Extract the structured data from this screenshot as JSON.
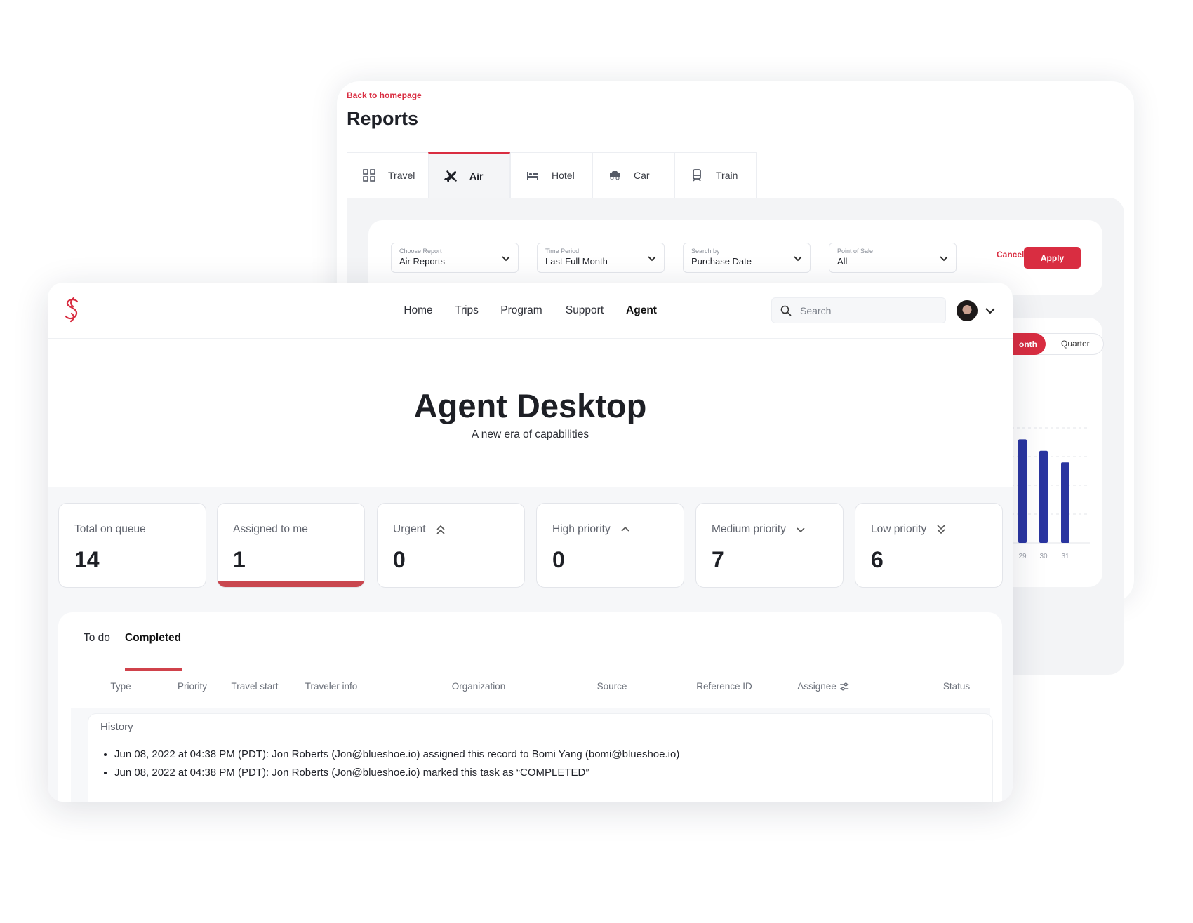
{
  "reports": {
    "back_link": "Back to homepage",
    "title": "Reports",
    "tabs": [
      {
        "label": "Travel",
        "icon": "grid-icon"
      },
      {
        "label": "Air",
        "icon": "plane-icon",
        "active": true
      },
      {
        "label": "Hotel",
        "icon": "bed-icon"
      },
      {
        "label": "Car",
        "icon": "car-icon"
      },
      {
        "label": "Train",
        "icon": "train-icon"
      }
    ],
    "filters": [
      {
        "label": "Choose Report",
        "value": "Air Reports"
      },
      {
        "label": "Time Period",
        "value": "Last Full Month"
      },
      {
        "label": "Search by",
        "value": "Purchase Date"
      },
      {
        "label": "Point of Sale",
        "value": "All"
      }
    ],
    "cancel": "Cancel",
    "apply": "Apply",
    "toggle": {
      "month": "onth",
      "quarter": "Quarter",
      "selected": "month"
    }
  },
  "chart_data": {
    "type": "bar",
    "categories": [
      "29",
      "30",
      "31"
    ],
    "values": [
      3.6,
      3.2,
      2.8
    ],
    "ylim": [
      0,
      4
    ],
    "grid": true,
    "color": "#2a35a0"
  },
  "agent": {
    "nav": [
      "Home",
      "Trips",
      "Program",
      "Support",
      "Agent"
    ],
    "nav_active": "Agent",
    "search_placeholder": "Search",
    "title": "Agent Desktop",
    "subtitle": "A new era of capabilities",
    "cards": [
      {
        "label": "Total on queue",
        "value": "14"
      },
      {
        "label": "Assigned to me",
        "value": "1",
        "selected": true
      },
      {
        "label": "Urgent",
        "value": "0",
        "icon": "double-chevron-up-icon"
      },
      {
        "label": "High priority",
        "value": "0",
        "icon": "chevron-up-icon"
      },
      {
        "label": "Medium priority",
        "value": "7",
        "icon": "chevron-down-icon"
      },
      {
        "label": "Low priority",
        "value": "6",
        "icon": "double-chevron-down-icon"
      }
    ],
    "tabs": {
      "todo": "To do",
      "completed": "Completed",
      "active": "Completed"
    },
    "columns": [
      "Type",
      "Priority",
      "Travel start",
      "Traveler info",
      "Organization",
      "Source",
      "Reference ID",
      "Assignee",
      "Status"
    ],
    "history": {
      "title": "History",
      "items": [
        "Jun 08, 2022 at 04:38 PM (PDT): Jon Roberts (Jon@blueshoe.io) assigned this record to Bomi Yang (bomi@blueshoe.io)",
        "Jun 08, 2022 at 04:38 PM (PDT): Jon Roberts (Jon@blueshoe.io) marked this task as “COMPLETED”"
      ]
    },
    "colors": {
      "accent": "#d92d41",
      "selected_bar": "#c9474f"
    }
  }
}
